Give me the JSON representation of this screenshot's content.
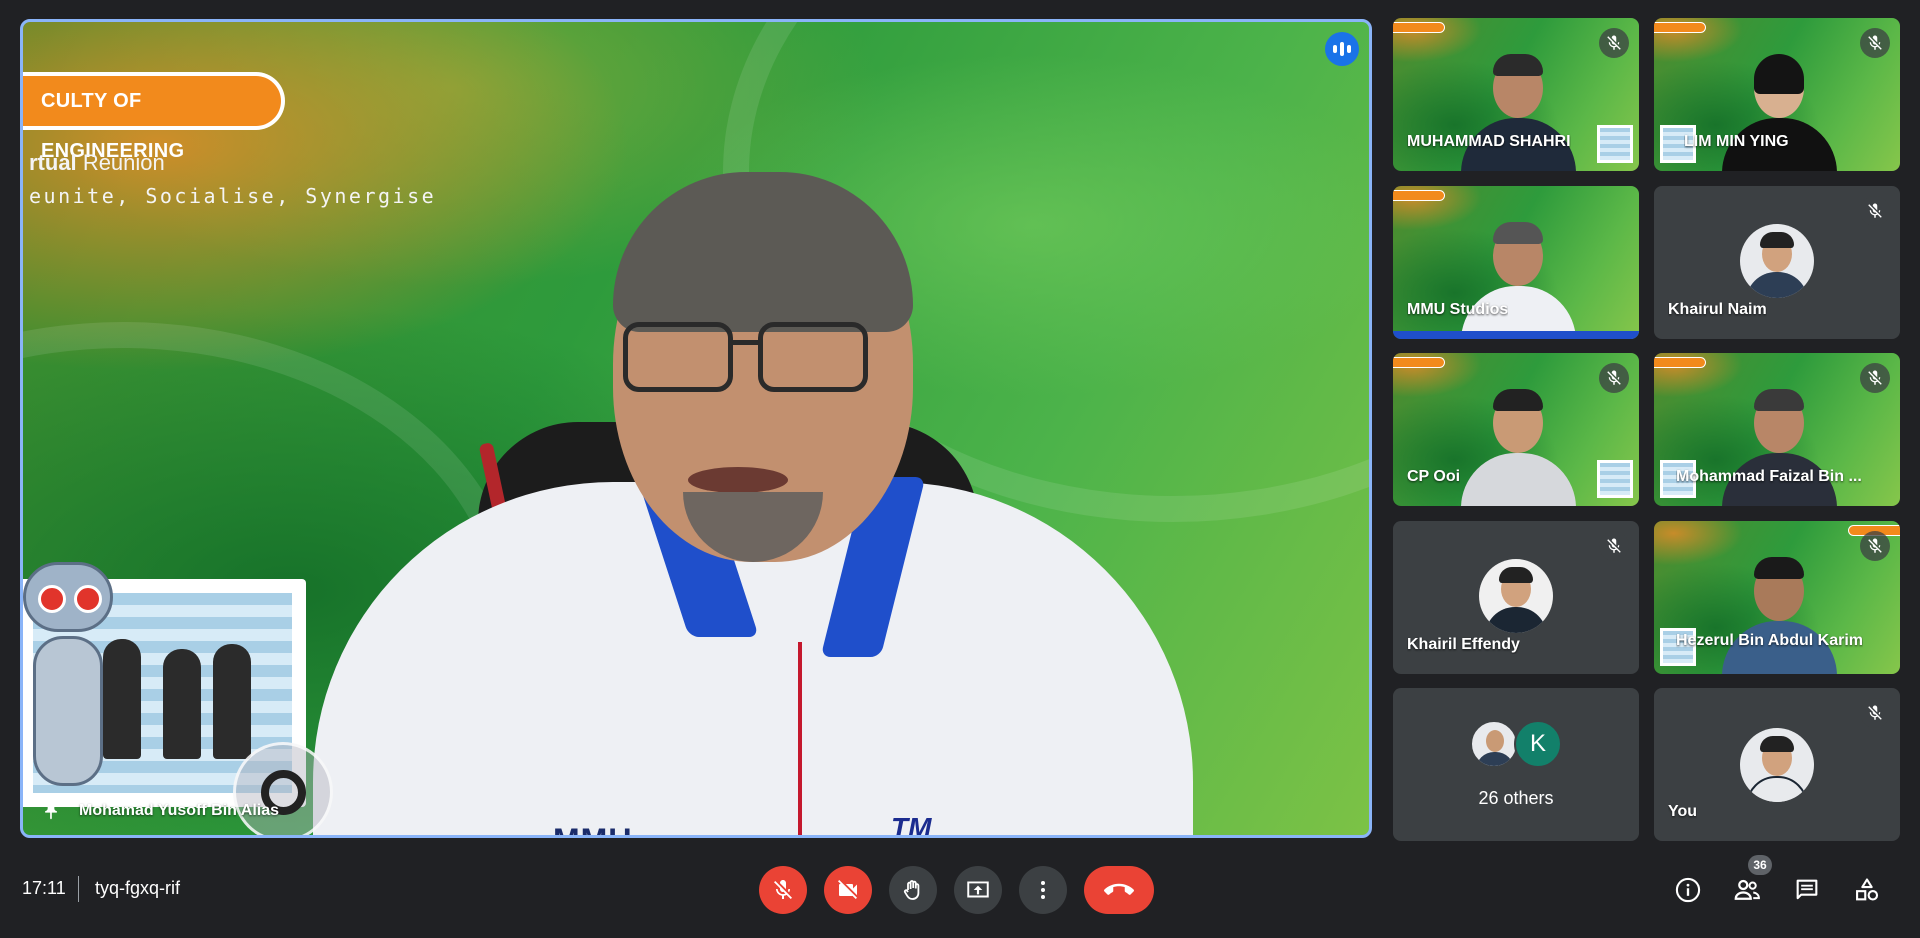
{
  "main_speaker": {
    "name": "Mohamad Yusoff Bin Alias",
    "banner_title": "CULTY OF ENGINEERING",
    "banner_line1_prefix": "rtual",
    "banner_line1_suffix": "Reunion",
    "banner_line2": "eunite, Socialise, Synergise",
    "shirt_logo_left": "MMU",
    "shirt_logo_right": "TM",
    "pinned": true,
    "speaking": true
  },
  "participants": [
    {
      "name": "MUHAMMAD SHAHRI",
      "type": "video",
      "muted": true
    },
    {
      "name": "LIM MIN YING",
      "type": "video",
      "muted": true
    },
    {
      "name": "MMU Studios",
      "type": "video",
      "muted": false
    },
    {
      "name": "Khairul Naim",
      "type": "avatar",
      "muted": true
    },
    {
      "name": "CP Ooi",
      "type": "video",
      "muted": true
    },
    {
      "name": "Mohammad Faizal Bin ...",
      "type": "video",
      "muted": true
    },
    {
      "name": "Khairil Effendy",
      "type": "avatar",
      "muted": true
    },
    {
      "name": "Hezerul Bin Abdul Karim",
      "type": "video",
      "muted": true
    },
    {
      "name": "You",
      "type": "avatar",
      "muted": true
    }
  ],
  "others": {
    "label": "26 others",
    "avatar_letter": "K"
  },
  "bottom_bar": {
    "time": "17:11",
    "meeting_code": "tyq-fgxq-rif",
    "participant_count": "36"
  },
  "icons": {
    "mic": "mic-off-icon",
    "camera": "videocam-off-icon",
    "hand": "raise-hand-icon",
    "present": "present-screen-icon",
    "more": "more-vert-icon",
    "end": "call-end-icon",
    "info": "info-icon",
    "people": "people-icon",
    "chat": "chat-icon",
    "activities": "activities-icon"
  },
  "colors": {
    "background": "#202124",
    "tile": "#3c4043",
    "danger": "#ea4335",
    "accent": "#8ab4f8",
    "speaking": "#1a73e8",
    "badge": "#f28a1c"
  }
}
